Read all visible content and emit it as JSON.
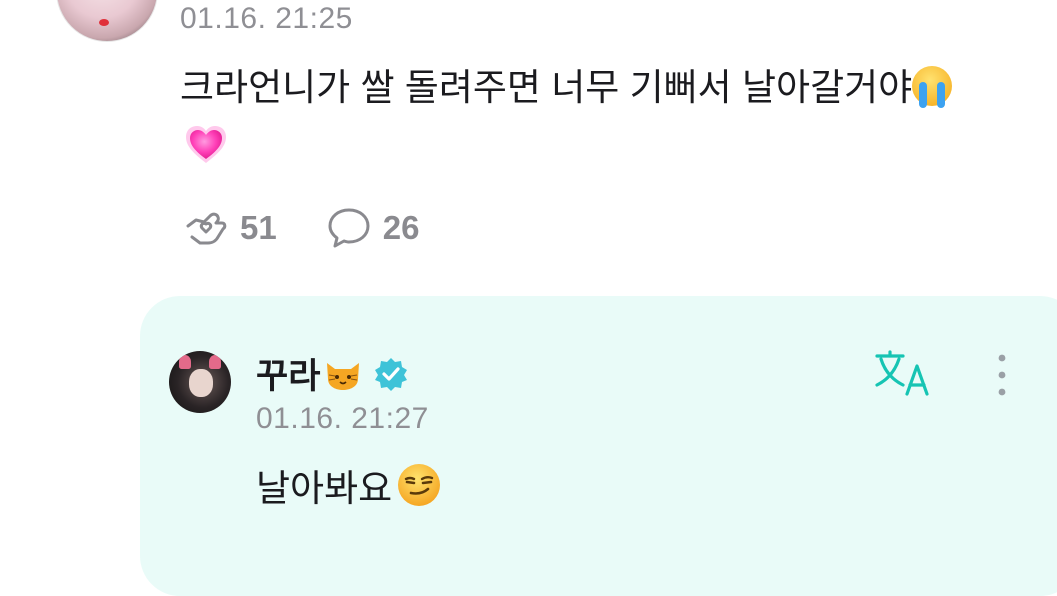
{
  "post": {
    "timestamp": "01.16. 21:25",
    "text": "크라언니가 쌀 돌려주면 너무 기뻐서 날아갈거야",
    "emoji_after_text": "loudly-crying-face",
    "emoji_line2": "growing-heart",
    "likes_count": "51",
    "comments_count": "26"
  },
  "reply": {
    "author_name": "꾸라",
    "name_emoji": "cat-face",
    "verified": true,
    "timestamp": "01.16. 21:27",
    "text": "날아봐요",
    "emoji_after_text": "smirking-face"
  },
  "colors": {
    "reply_card_bg": "#e9fbf8",
    "accent_teal": "#16c4b3",
    "verified_blue": "#3ec3d8",
    "meta_gray": "#8f8f94"
  },
  "icons": {
    "like": "hand-heart-icon",
    "comment": "speech-bubble-icon",
    "translate": "translate-icon",
    "more": "more-vertical-icon"
  }
}
